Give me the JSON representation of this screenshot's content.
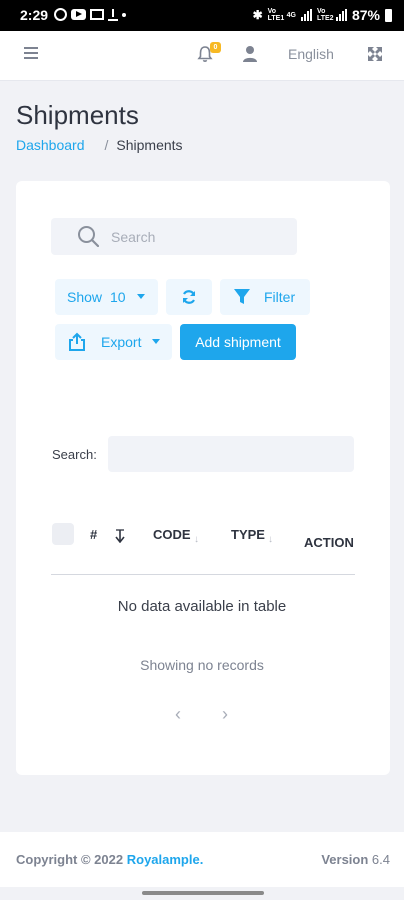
{
  "status_bar": {
    "time": "2:29",
    "battery": "87%",
    "net_1": "Vo LTE1",
    "net_2": "Vo LTE2",
    "net_3": "4G"
  },
  "topnav": {
    "notification_count": "0",
    "language": "English"
  },
  "page": {
    "title": "Shipments",
    "breadcrumb": [
      "Dashboard",
      "/",
      "Shipments"
    ]
  },
  "toolbar": {
    "search_placeholder": "Search",
    "show_label": "Show",
    "show_value": "10",
    "filter_label": "Filter",
    "export_label": "Export",
    "add_label": "Add shipment"
  },
  "table": {
    "search_label": "Search:",
    "columns": [
      "#",
      "CODE",
      "TYPE",
      "ACTION"
    ],
    "empty_message": "No data available in table",
    "records_info": "Showing no records",
    "prev": "‹",
    "next": "›"
  },
  "footer": {
    "copyright": "Copyright © 2022",
    "brand": "Royalample.",
    "version_label": "Version",
    "version_value": "6.4"
  },
  "colors": {
    "accent": "#1ea6ec",
    "background": "#f1f2f6",
    "badge": "#f7b924"
  }
}
